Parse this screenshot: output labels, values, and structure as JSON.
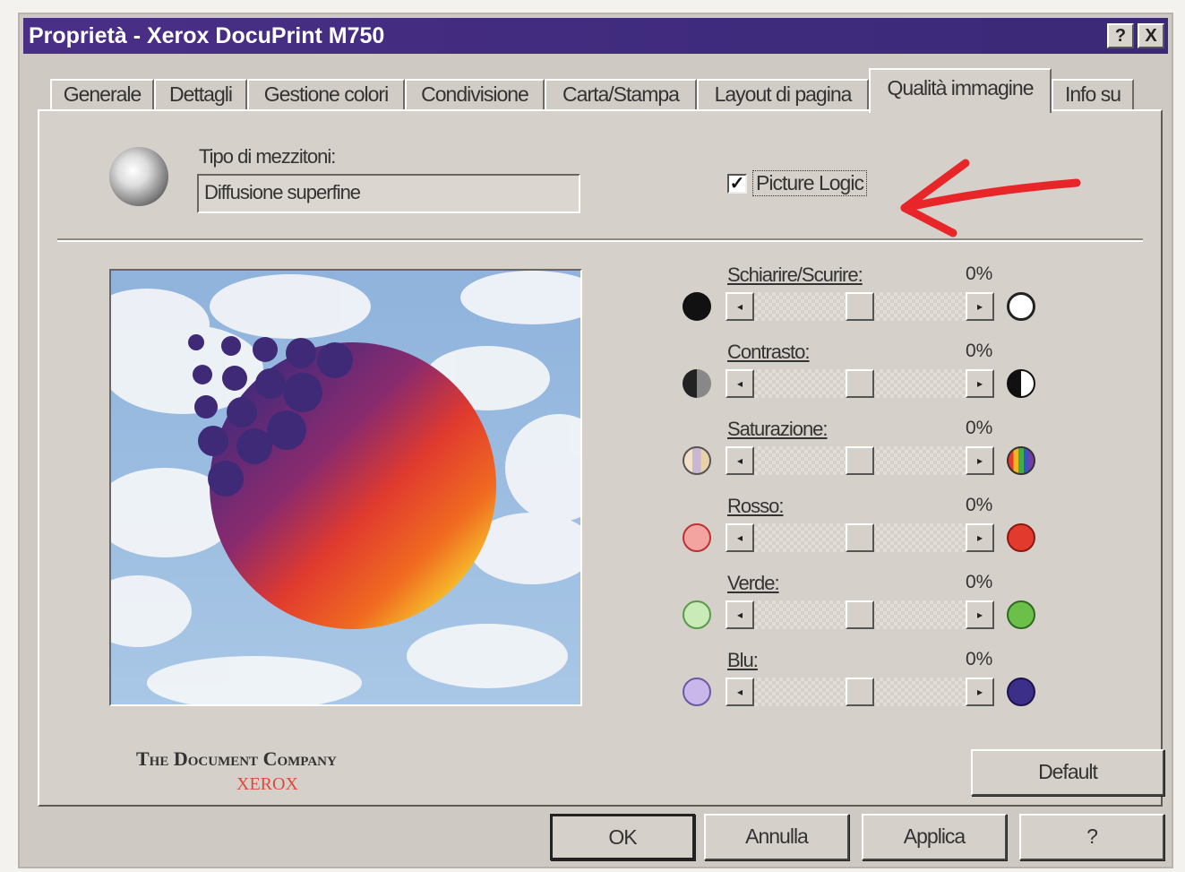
{
  "window": {
    "title": "Proprietà - Xerox DocuPrint M750",
    "help_label": "?",
    "close_label": "X"
  },
  "tabs": [
    {
      "label": "Generale"
    },
    {
      "label": "Dettagli"
    },
    {
      "label": "Gestione colori"
    },
    {
      "label": "Condivisione"
    },
    {
      "label": "Carta/Stampa"
    },
    {
      "label": "Layout di pagina"
    },
    {
      "label": "Qualità immagine",
      "active": true
    },
    {
      "label": "Info su"
    }
  ],
  "halftone": {
    "label": "Tipo di mezzitoni:",
    "value": "Diffusione superfine"
  },
  "picture_logic": {
    "label": "Picture Logic",
    "checked": true,
    "check_glyph": "✓"
  },
  "sliders": [
    {
      "label": "Schiarire/Scurire:",
      "value": "0%",
      "left_icon": "black-dot-icon",
      "right_icon": "white-dot-icon"
    },
    {
      "label": "Contrasto:",
      "value": "0%",
      "left_icon": "low-contrast-icon",
      "right_icon": "high-contrast-icon"
    },
    {
      "label": "Saturazione:",
      "value": "0%",
      "left_icon": "low-saturation-icon",
      "right_icon": "high-saturation-icon"
    },
    {
      "label": "Rosso:",
      "value": "0%",
      "left_icon": "light-red-icon",
      "right_icon": "red-icon"
    },
    {
      "label": "Verde:",
      "value": "0%",
      "left_icon": "light-green-icon",
      "right_icon": "green-icon"
    },
    {
      "label": "Blu:",
      "value": "0%",
      "left_icon": "light-blue-icon",
      "right_icon": "blue-icon"
    }
  ],
  "slider_position": 0.5,
  "branding": {
    "tagline": "The Document Company",
    "brand": "XEROX"
  },
  "buttons": {
    "default": "Default",
    "ok": "OK",
    "cancel": "Annulla",
    "apply": "Applica",
    "help": "?"
  },
  "colors": {
    "titlebar": "#3f2b7d",
    "dialog": "#d5d0ca",
    "annotation_arrow": "#e8262a",
    "brand_red": "#e14a3c"
  }
}
